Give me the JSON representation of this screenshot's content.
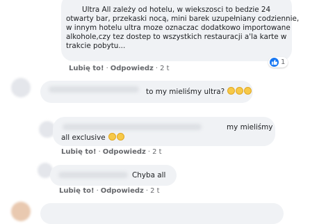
{
  "comments": [
    {
      "lines": [
        "Ultra All zależy od hotelu, w wiekszosci to bedzie 24",
        "otwarty bar, przekaski nocą, mini barek uzupełniany codziennie,",
        "w innym hotelu ultra moze oznaczac dodatkowo importowane",
        "alkohole,czy tez dostep to wszystkich restauracji a'la karte w",
        "trakcie pobytu..."
      ],
      "like": "Lubię to!",
      "reply": "Odpowiedz",
      "time": "2 t",
      "reaction_count": "1"
    },
    {
      "text": "to my mieliśmy ultra?",
      "emoji_count": 3,
      "emoji_icon": "thinking-face-emoji"
    },
    {
      "line1": "my mieliśmy",
      "line2": "all exclusive",
      "like": "Lubię to!",
      "reply": "Odpowiedz",
      "time": "2 t",
      "emoji_icons": [
        "grinning-face-emoji",
        "smiling-face-emoji"
      ]
    },
    {
      "text": "Chyba all",
      "like": "Lubię to!",
      "reply": "Odpowiedz",
      "time": "2 t"
    }
  ],
  "colors": {
    "bubble": "#f0f2f5",
    "meta": "#65676b",
    "like_blue": "#1877f2"
  }
}
